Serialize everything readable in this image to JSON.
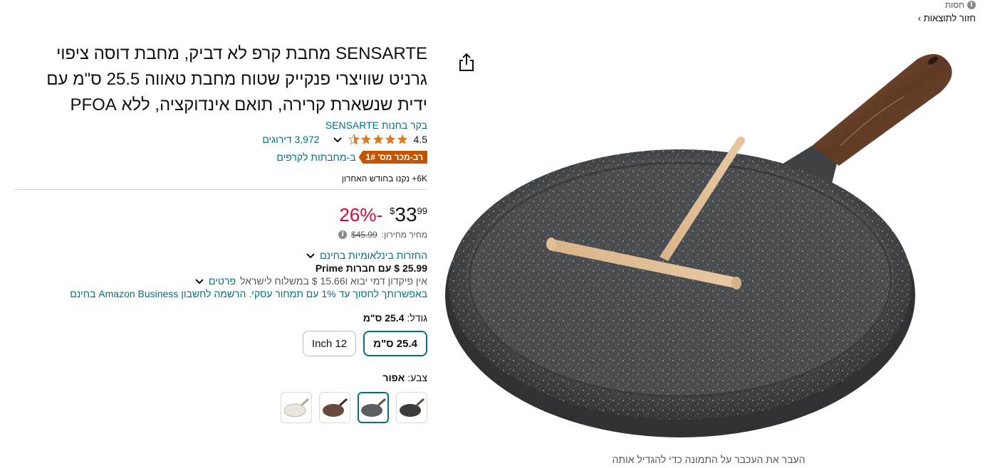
{
  "topbar": {
    "label": "חסות",
    "icon": "info-icon"
  },
  "nav": {
    "back_label": "‹ חזור לתוצאות"
  },
  "product": {
    "title": "SENSARTE מחבת קרפ לא דביק, מחבת דוסה ציפוי גרניט שוויצרי פנקייק שטוח מחבת טאווה 25.5 ס\"מ עם ידית שנשארת קרירה, תואם אינדוקציה, ללא PFOA",
    "store_link": "בקר בחנות SENSARTE",
    "rating": "4.5",
    "rating_value": 4.5,
    "reviews": "3,972 דירוגים",
    "badge": "רב-מכר מס' 1#",
    "badge_category": "ב-מחבתות לקרפים",
    "bought": "6K+ נקנו בחודש האחרון",
    "image_hint": "העבר את העכבר על התמונה כדי להגדיל אותה"
  },
  "pricing": {
    "discount": "-26%",
    "currency": "$",
    "whole": "33",
    "fraction": "99",
    "list_label": "מחיר מחירון:",
    "list_price": "$45.99",
    "returns": "החזרות בינלאומיות בחינם",
    "prime_line": "25.99 $ עם חברות Prime",
    "shipping": "אין פיקדון דמי יבוא ו15.66 $ במשלוח לישראל",
    "shipping_details": "פרטים",
    "business": "באפשרותך לחסוך עד 1% עם תמחור עסקי. הרשמה לחשבון Amazon Business בחינם"
  },
  "size": {
    "label": "גודל:",
    "selected": "25.4 ס\"מ",
    "options": [
      "25.4 ס\"מ",
      "12 Inch"
    ]
  },
  "color": {
    "label": "צבע:",
    "selected": "אפור",
    "swatch_colors": [
      "#3a3b3c",
      "#5b5e61",
      "#6b4a3e",
      "#e9e6dc"
    ]
  },
  "colors": {
    "link": "#007185",
    "discount": "#cc0c39",
    "badge": "#c45500",
    "star": "#de7921"
  }
}
